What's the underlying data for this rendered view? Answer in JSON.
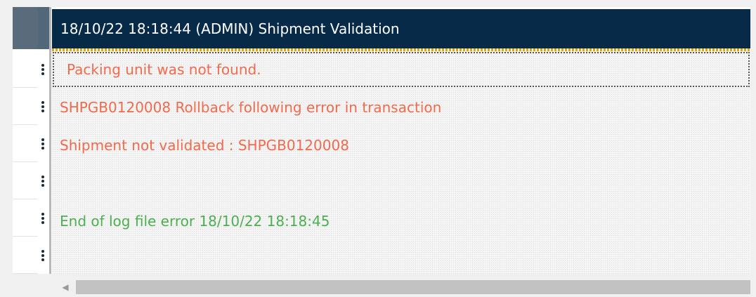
{
  "window": {
    "header_title": "18/10/22 18:18:44 (ADMIN) Shipment Validation"
  },
  "log": {
    "rows": [
      {
        "text": "Packing unit was not found.",
        "level": "error"
      },
      {
        "text": "SHPGB0120008 Rollback following error in transaction",
        "level": "error"
      },
      {
        "text": "Shipment not validated : SHPGB0120008",
        "level": "error"
      },
      {
        "text": "",
        "level": "empty"
      },
      {
        "text": "End of log file error 18/10/22 18:18:45",
        "level": "success"
      },
      {
        "text": "",
        "level": "empty"
      }
    ]
  },
  "colors": {
    "header_bg": "#062a47",
    "header_accent": "#e5a400",
    "error_text": "#f26a4b",
    "success_text": "#4caf50",
    "handle_dots": "#1d2a38"
  },
  "icons": {
    "row_handle": "vertical-dots-icon",
    "scroll_left": "caret-left-icon"
  }
}
